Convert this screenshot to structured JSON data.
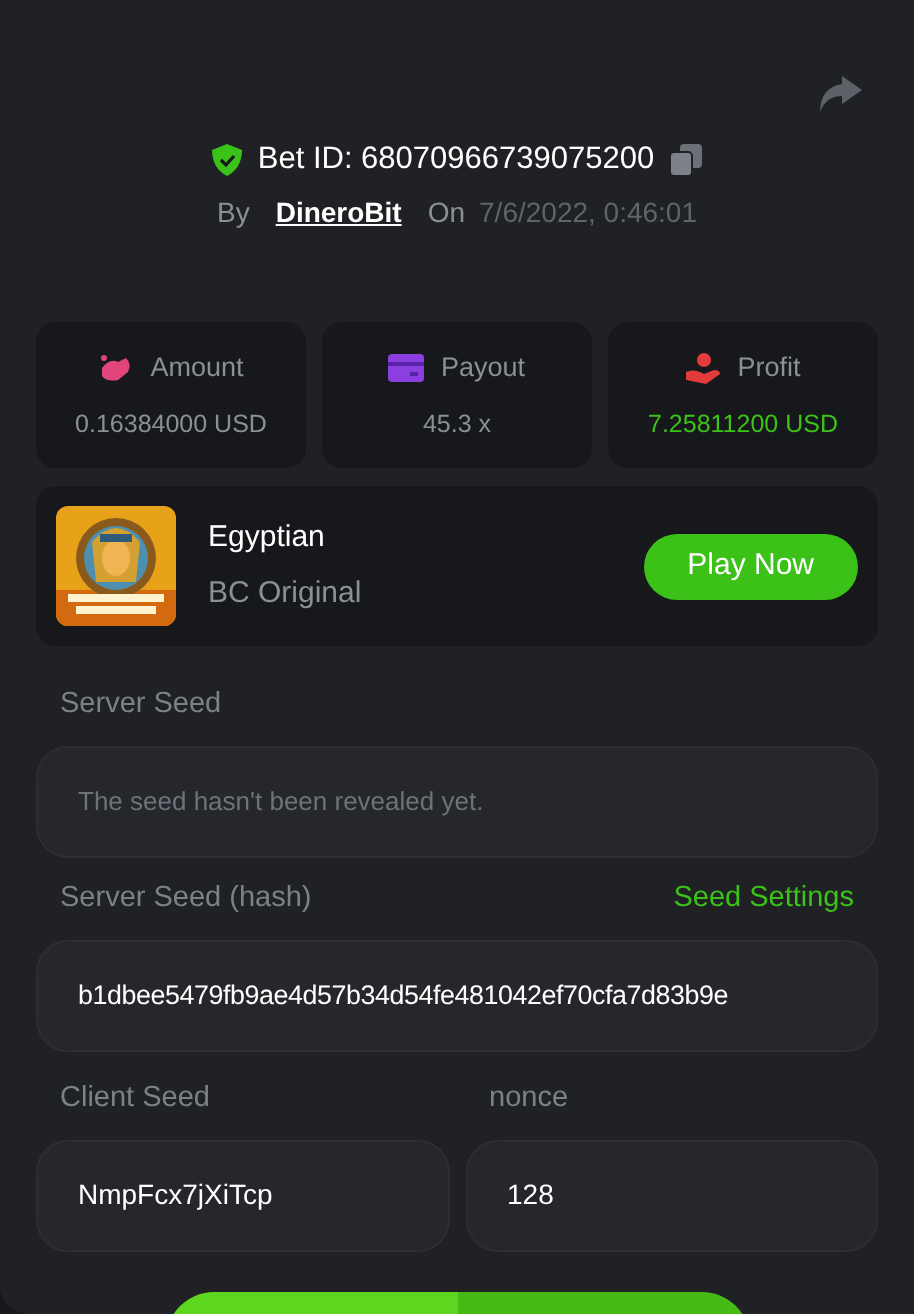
{
  "bet": {
    "title": "Bet ID: 68070966739075200",
    "by_label": "By",
    "user": "DineroBit",
    "on_label": "On",
    "date": "7/6/2022, 0:46:01"
  },
  "stats": [
    {
      "label": "Amount",
      "value": "0.16384000 USD",
      "kind": "amount"
    },
    {
      "label": "Payout",
      "value": "45.3 x",
      "kind": "payout"
    },
    {
      "label": "Profit",
      "value": "7.25811200 USD",
      "kind": "profit"
    }
  ],
  "game": {
    "name": "Egyptian",
    "provider": "BC Original",
    "button": "Play Now"
  },
  "server_seed": {
    "label": "Server Seed",
    "value": "The seed hasn't been revealed yet."
  },
  "server_seed_hash": {
    "label": "Server Seed (hash)",
    "link": "Seed Settings",
    "value": "b1dbee5479fb9ae4d57b34d54fe481042ef70cfa7d83b9e"
  },
  "client_seed": {
    "label": "Client Seed",
    "value": "NmpFcx7jXiTcp"
  },
  "nonce": {
    "label": "nonce",
    "value": "128"
  },
  "verify_button": {
    "kind": "cut"
  }
}
